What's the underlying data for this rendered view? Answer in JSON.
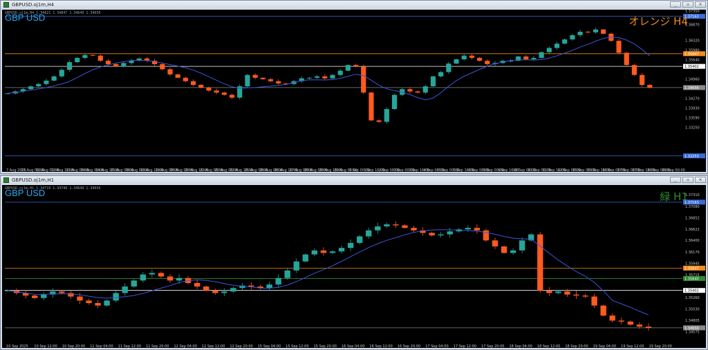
{
  "colors": {
    "bull": "#26a69a",
    "bear": "#ff5a1f",
    "ma": "#3b56d9",
    "orange": "#f28c1a",
    "white": "#ffffff",
    "green": "#2e8b2e",
    "blue": "#2d6bff"
  },
  "windows": [
    {
      "title": "GBPUSD.oj1m,H4",
      "ohlc": "GBPUSD.oj1m,H4 1.34821 1.34847 1.34649 1.34656",
      "symbol": "GBP USD",
      "tag": "オレンジ H4",
      "tag_color": "#f28c1a",
      "y_range": [
        1.3198,
        1.373
      ],
      "y_ticks": [
        1.3735,
        1.3687,
        1.3632,
        1.3598,
        1.3564,
        1.35402,
        1.3496,
        1.34656,
        1.3427,
        1.3393,
        1.3359,
        1.3325
      ],
      "levels": [
        {
          "value": 1.37163,
          "color": "#3b6bd9",
          "label": "1.37163"
        },
        {
          "value": 1.35847,
          "color": "#f28c1a",
          "label": "1.35847"
        },
        {
          "value": 1.35402,
          "color": "#ffffff",
          "label": "1.35402"
        },
        {
          "value": 1.34656,
          "color": "#8a8a8a",
          "label": "1.34656"
        },
        {
          "value": 1.32253,
          "color": "#3b6bd9",
          "label": "1.32253"
        }
      ],
      "x_labels": [
        "7 Aug 2025",
        "11 Aug 08:00",
        "12 Aug 00:00",
        "12 Aug 16:00",
        "13 Aug 08:00",
        "14 Aug 00:00",
        "14 Aug 16:00",
        "15 Aug 08:00",
        "18 Aug 00:00",
        "18 Aug 16:00",
        "19 Aug 08:00",
        "20 Aug 00:00",
        "20 Aug 16:00",
        "21 Aug 08:00",
        "22 Aug 00:00",
        "22 Aug 16:00",
        "25 Aug 08:00",
        "26 Aug 00:00",
        "26 Aug 16:00",
        "27 Aug 08:00",
        "28 Aug 00:00",
        "28 Aug 16:00",
        "29 Aug 08:00",
        "1 Sep 00:00",
        "1 Sep 16:00",
        "2 Sep 08:00",
        "3 Sep 00:00",
        "3 Sep 16:00",
        "4 Sep 08:00",
        "5 Sep 00:00",
        "5 Sep 16:00",
        "8 Sep 08:00",
        "9 Sep 00:00",
        "9 Sep 16:00",
        "10 Sep 08:00",
        "11 Sep 00:00",
        "11 Sep 16:00",
        "12 Sep 08:00",
        "15 Sep 00:00",
        "15 Sep 16:00",
        "16 Sep 08:00",
        "17 Sep 00:00",
        "17 Sep 16:00",
        "18 Sep 08:00",
        "19 Sep 00:00"
      ],
      "path": [
        1.3445,
        1.3452,
        1.346,
        1.347,
        1.3478,
        1.349,
        1.3505,
        1.3528,
        1.3555,
        1.357,
        1.358,
        1.3578,
        1.356,
        1.3548,
        1.354,
        1.3552,
        1.356,
        1.3568,
        1.356,
        1.3548,
        1.353,
        1.3512,
        1.35,
        1.3488,
        1.3475,
        1.3465,
        1.3455,
        1.3448,
        1.344,
        1.343,
        1.347,
        1.351,
        1.35,
        1.3495,
        1.3488,
        1.348,
        1.3478,
        1.3488,
        1.3498,
        1.35,
        1.3505,
        1.3498,
        1.351,
        1.3525,
        1.3545,
        1.354,
        1.3448,
        1.335,
        1.3345,
        1.339,
        1.344,
        1.346,
        1.3452,
        1.3448,
        1.347,
        1.3505,
        1.352,
        1.355,
        1.3565,
        1.3578,
        1.357,
        1.356,
        1.3548,
        1.3552,
        1.356,
        1.356,
        1.3575,
        1.3565,
        1.357,
        1.359,
        1.3605,
        1.362,
        1.3635,
        1.365,
        1.3662,
        1.366,
        1.367,
        1.3655,
        1.363,
        1.3588,
        1.3545,
        1.351,
        1.3475,
        1.3465
      ]
    },
    {
      "title": "GBPUSD.oj1m,H1",
      "ohlc": "GBPUSD.oj1m,H1 1.34719 1.34740 1.34649 1.34656",
      "symbol": "GBP USD",
      "tag": "緑 H1",
      "tag_color": "#2e8b2e",
      "y_range": [
        1.3442,
        1.3745
      ],
      "y_ticks": [
        1.3731,
        1.3708,
        1.36852,
        1.36622,
        1.364,
        1.3617,
        1.35945,
        1.35847,
        1.35715,
        1.3564,
        1.35402,
        1.3526,
        1.3503,
        1.34805,
        1.34656,
        1.34575
      ],
      "levels": [
        {
          "value": 1.37163,
          "color": "#3b6bd9",
          "label": "1.37163"
        },
        {
          "value": 1.35847,
          "color": "#f28c1a",
          "label": "1.35847"
        },
        {
          "value": 1.3564,
          "color": "#2e8b2e",
          "label": "1.35640"
        },
        {
          "value": 1.35402,
          "color": "#ffffff",
          "label": "1.35402"
        },
        {
          "value": 1.34656,
          "color": "#8a8a8a",
          "label": "1.34656"
        }
      ],
      "x_labels": [
        "10 Sep 2025",
        "10 Sep 12:00",
        "10 Sep 20:00",
        "11 Sep 04:00",
        "11 Sep 12:00",
        "11 Sep 20:00",
        "12 Sep 04:00",
        "12 Sep 12:00",
        "12 Sep 20:00",
        "15 Sep 04:00",
        "15 Sep 12:00",
        "15 Sep 20:00",
        "16 Sep 04:00",
        "16 Sep 12:00",
        "16 Sep 20:00",
        "17 Sep 04:00",
        "17 Sep 12:00",
        "17 Sep 20:00",
        "18 Sep 04:00",
        "18 Sep 12:00",
        "18 Sep 20:00",
        "19 Sep 04:00",
        "19 Sep 12:00",
        "19 Sep 20:00"
      ],
      "path": [
        1.354,
        1.3535,
        1.353,
        1.3525,
        1.3532,
        1.3538,
        1.3535,
        1.3528,
        1.352,
        1.3515,
        1.351,
        1.352,
        1.3535,
        1.3548,
        1.356,
        1.3572,
        1.3575,
        1.3568,
        1.356,
        1.3565,
        1.3555,
        1.3548,
        1.354,
        1.3535,
        1.3538,
        1.3545,
        1.355,
        1.3548,
        1.3545,
        1.3552,
        1.3565,
        1.358,
        1.3598,
        1.3612,
        1.362,
        1.3615,
        1.3618,
        1.3625,
        1.3635,
        1.3648,
        1.366,
        1.3668,
        1.3672,
        1.367,
        1.3665,
        1.366,
        1.3655,
        1.365,
        1.3652,
        1.3658,
        1.3662,
        1.3665,
        1.366,
        1.364,
        1.3628,
        1.3615,
        1.362,
        1.364,
        1.3652,
        1.354,
        1.3535,
        1.3538,
        1.3532,
        1.353,
        1.3528,
        1.351,
        1.349,
        1.348,
        1.3478,
        1.3472,
        1.3468,
        1.3466
      ]
    }
  ]
}
